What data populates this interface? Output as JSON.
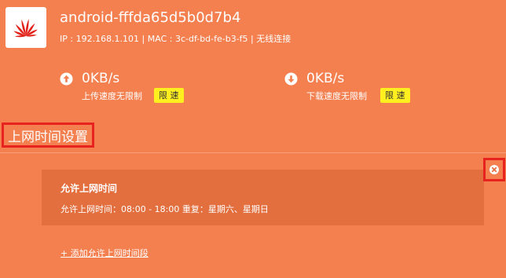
{
  "device": {
    "name": "android-fffda65d5b0d7b4",
    "info": "IP : 192.168.1.101 | MAC : 3c-df-bd-fe-b3-f5 | 无线连接",
    "logo_icon": "huawei-logo"
  },
  "upload": {
    "icon": "arrow-up-circle-icon",
    "value": "0KB/s",
    "status": "上传速度无限制",
    "limit_label": "限 速"
  },
  "download": {
    "icon": "arrow-down-circle-icon",
    "value": "0KB/s",
    "status": "下载速度无限制",
    "limit_label": "限 速"
  },
  "section": {
    "title": "上网时间设置"
  },
  "rule": {
    "title": "允许上网时间",
    "detail": "允许上网时间：08:00 - 18:00   重复：星期六、星期日"
  },
  "add_link": "+ 添加允许上网时间段",
  "colors": {
    "background": "#F47F4F",
    "card": "#E36E3E",
    "limit_button": "#FFEF1F",
    "highlight_border": "#E8221F",
    "brand_red": "#E1211A"
  }
}
